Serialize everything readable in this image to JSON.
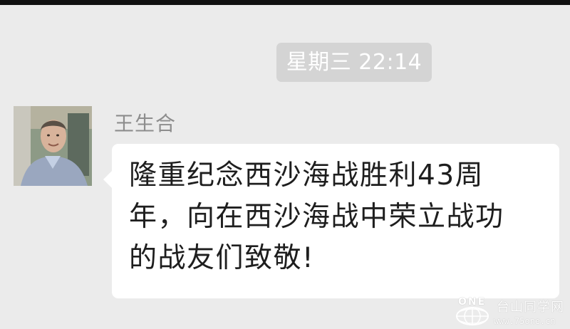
{
  "chat": {
    "timestamp": "星期三 22:14",
    "message": {
      "sender_name": "王生合",
      "text_lines": [
        "隆重纪念西沙海战胜利43周",
        "年，向在西沙海战中荣立战功",
        "的战友们致敬!"
      ]
    }
  },
  "watermark": {
    "logo_text": "ONE",
    "title": "台山同学网",
    "url": "www.75one.cn"
  },
  "colors": {
    "chat_background": "#ebebeb",
    "bubble_background": "#ffffff",
    "timestamp_background": "#d4d4d4",
    "name_text": "#8d8d8d",
    "message_text": "#1e1e1e"
  },
  "icons": {
    "avatar": "user-photo-icon",
    "watermark_logo": "globe-logo-icon"
  }
}
